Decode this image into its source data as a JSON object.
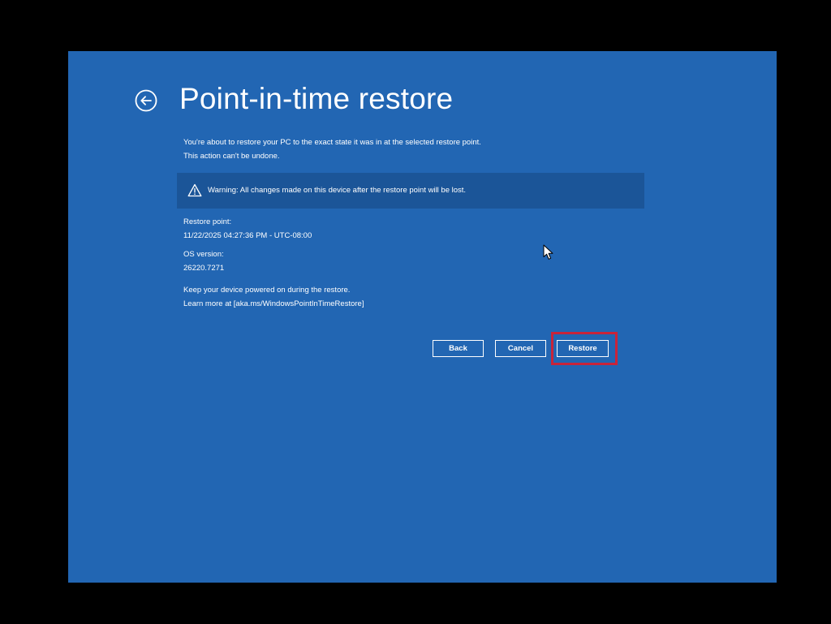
{
  "header": {
    "title": "Point-in-time restore",
    "back_icon": "back-arrow-circle-icon"
  },
  "description": {
    "line1": "You're about to restore your PC to the exact state it was in at the selected restore point.",
    "line2": "This action can't be undone."
  },
  "warning": {
    "icon": "warning-triangle-icon",
    "text": "Warning: All changes made on this device after the restore point will be lost."
  },
  "details": {
    "restore_point_label": "Restore point:",
    "restore_point_value": "11/22/2025 04:27:36 PM - UTC-08:00",
    "os_version_label": "OS version:",
    "os_version_value": "26220.7271"
  },
  "notes": {
    "power": "Keep your device powered on during the restore.",
    "learn_more": "Learn more at [aka.ms/WindowsPointInTimeRestore]"
  },
  "buttons": {
    "back": "Back",
    "cancel": "Cancel",
    "restore": "Restore"
  },
  "colors": {
    "background": "#2266b3",
    "warning_background": "#1b5598",
    "highlight": "#c8243a",
    "outer": "#000000"
  }
}
